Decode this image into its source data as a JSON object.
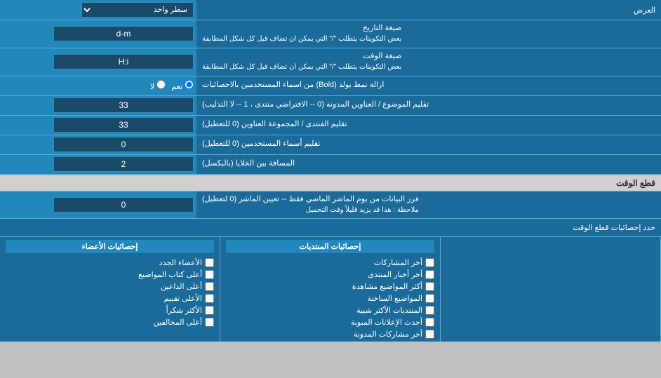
{
  "top": {
    "label": "العرض",
    "select_value": "سطر واحد"
  },
  "rows": [
    {
      "id": "date_format",
      "label": "صيغة التاريخ\nبعض التكوينات يتطلب \"/\" التي يمكن ان تضاف قبل كل شكل المطابقة",
      "input_value": "d-m",
      "input_type": "text"
    },
    {
      "id": "time_format",
      "label": "صيغة الوقت\nبعض التكوينات يتطلب \"/\" التي يمكن ان تضاف قبل كل شكل المطابقة",
      "input_value": "H:i",
      "input_type": "text"
    },
    {
      "id": "bold_remove",
      "label": "ازالة نمط بولد (Bold) من اسماء المستخدمين بالاحصائيات",
      "radio_options": [
        "تعم",
        "لا"
      ],
      "radio_selected": "تعم"
    },
    {
      "id": "topic_sort",
      "label": "تقليم الموضوع / العناوين المدونة (0 -- الافتراضي منتدى ، 1 -- لا التذليب)",
      "input_value": "33",
      "input_type": "text"
    },
    {
      "id": "forum_sort",
      "label": "تقليم الفنتدى / المجموعة العناوين (0 للتعطيل)",
      "input_value": "33",
      "input_type": "text"
    },
    {
      "id": "username_sort",
      "label": "تقليم أسماء المستخدمين (0 للتعطيل)",
      "input_value": "0",
      "input_type": "text"
    },
    {
      "id": "cell_spacing",
      "label": "المسافة بين الخلايا (بالبكسل)",
      "input_value": "2",
      "input_type": "text"
    }
  ],
  "time_cut_section": {
    "header": "قطع الوقت",
    "row": {
      "label": "فرز البيانات من يوم الماضر الماضي فقط -- تعيين الماشر (0 لتعطيل)\nملاحظة : هذا قد يزيد قليلاً وقت التحميل",
      "input_value": "0"
    }
  },
  "checkboxes": {
    "header": "حدد إحصائيات قطع الوقت",
    "col1_header": "إحصائيات الأعضاء",
    "col1_items": [
      "الأعضاء الجدد",
      "أعلى كتاب المواضيع",
      "أعلى الداعين",
      "الأعلى تقييم",
      "الأكثر شكراً",
      "أعلى المخالفين"
    ],
    "col2_header": "إحصائيات المنتديات",
    "col2_items": [
      "أخر المشاركات",
      "أخر أخبار المنتدى",
      "أكثر المواضيع مشاهدة",
      "المواضيع الساخنة",
      "المنتديات الأكثر شبية",
      "أحدث الإعلانات المبوبة",
      "أخر مشاركات المدونة"
    ],
    "col3_items": []
  }
}
